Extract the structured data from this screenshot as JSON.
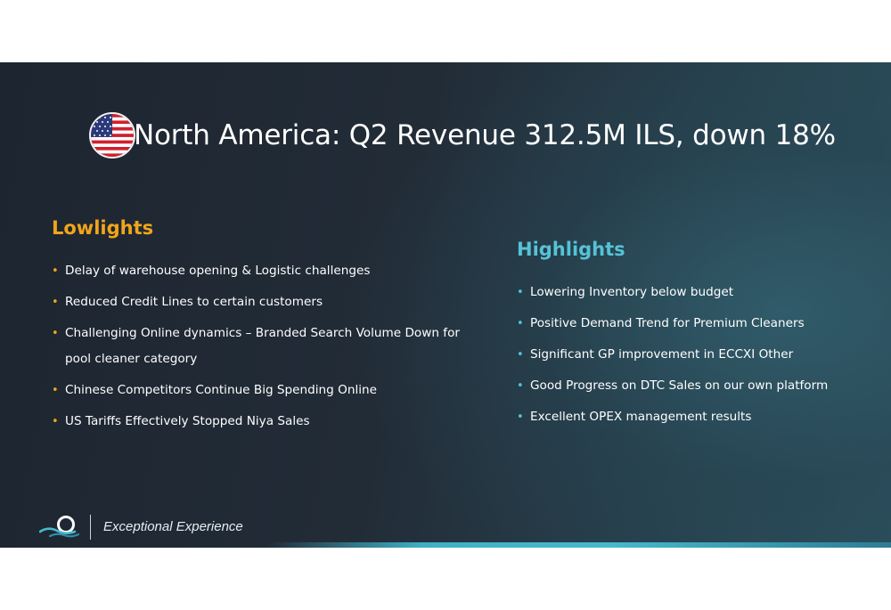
{
  "title": "North America: Q2 Revenue 312.5M ILS, down 18%",
  "flag_icon": "us-flag-icon",
  "colors": {
    "lowlights_accent": "#f2a51a",
    "highlights_accent": "#56c3d6",
    "title_text": "#ffffff"
  },
  "lowlights": {
    "heading": "Lowlights",
    "items": [
      "Delay of warehouse opening & Logistic challenges",
      "Reduced Credit Lines to certain customers",
      "Challenging Online dynamics – Branded Search Volume Down for pool cleaner category",
      "Chinese Competitors Continue Big Spending Online",
      "US Tariffs Effectively Stopped Niya Sales"
    ]
  },
  "highlights": {
    "heading": "Highlights",
    "items": [
      "Lowering Inventory below budget",
      "Positive Demand Trend for Premium Cleaners",
      "Significant GP improvement in ECCXI Other",
      "Good Progress on DTC Sales on our own platform",
      "Excellent OPEX management results"
    ]
  },
  "footer": {
    "logo_icon": "wave-logo-icon",
    "tagline": "Exceptional Experience"
  },
  "bullet_symbol": "•"
}
